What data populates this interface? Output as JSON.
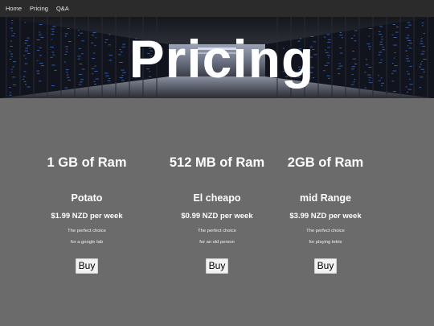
{
  "nav": {
    "items": [
      {
        "label": "Home"
      },
      {
        "label": "Pricing"
      },
      {
        "label": "Q&A"
      }
    ]
  },
  "hero": {
    "title": "Pricing"
  },
  "plans": [
    {
      "ram": "1 GB of Ram",
      "name": "Potato",
      "price": "$1.99 NZD per week",
      "desc_line1": "The perfect choice",
      "desc_line2": "for a google tab",
      "button_label": "Buy"
    },
    {
      "ram": "512 MB of Ram",
      "name": "El cheapo",
      "price": "$0.99 NZD per week",
      "desc_line1": "The perfect choice",
      "desc_line2": "for an old person",
      "button_label": "Buy"
    },
    {
      "ram": "2GB of Ram",
      "name": "mid Range",
      "price": "$3.99 NZD per week",
      "desc_line1": "The perfect choice",
      "desc_line2": "for playing tetris",
      "button_label": "Buy"
    }
  ],
  "colors": {
    "page_background": "#6b6b6b",
    "navbar_background": "#2b2b2b",
    "text": "#ffffff",
    "button_background": "#f2f2f2",
    "server_light_accent": "#3a6fd8"
  }
}
